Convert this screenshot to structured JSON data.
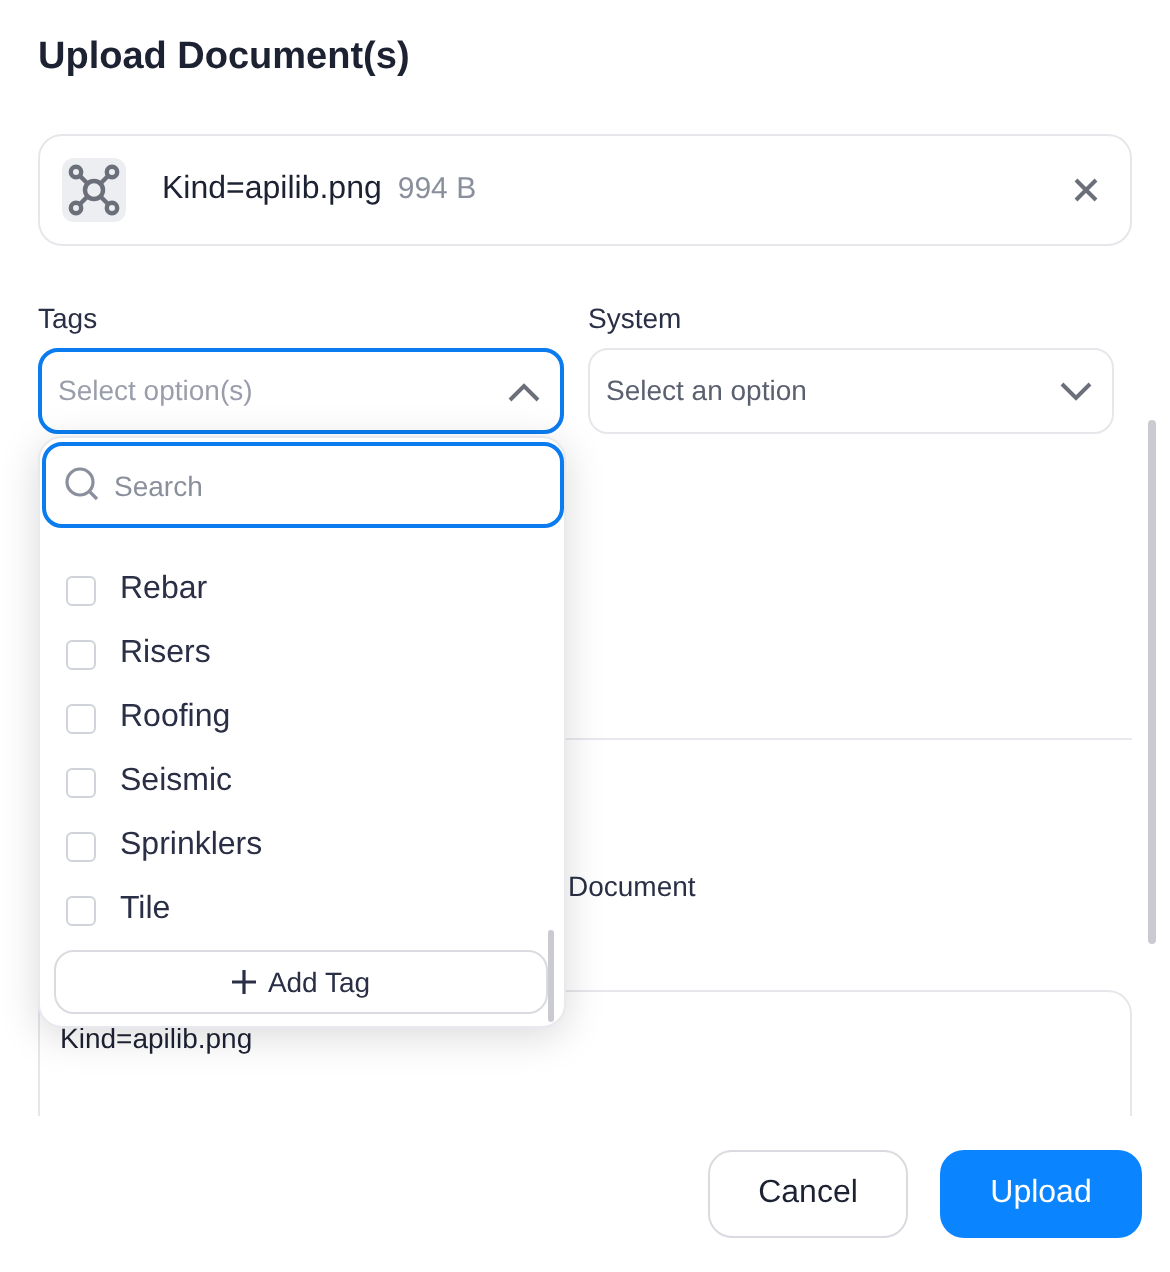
{
  "dialog": {
    "title": "Upload Document(s)"
  },
  "file": {
    "name": "Kind=apilib.png",
    "size": "994 B"
  },
  "tags": {
    "label": "Tags",
    "placeholder": "Select option(s)",
    "expanded": true,
    "search": {
      "placeholder": "Search"
    },
    "options": [
      {
        "label": "Rebar",
        "checked": false
      },
      {
        "label": "Risers",
        "checked": false
      },
      {
        "label": "Roofing",
        "checked": false
      },
      {
        "label": "Seismic",
        "checked": false
      },
      {
        "label": "Sprinklers",
        "checked": false
      },
      {
        "label": "Tile",
        "checked": false
      }
    ],
    "add_button": "Add Tag"
  },
  "system": {
    "label": "System",
    "placeholder": "Select an option",
    "expanded": false
  },
  "document_label": "Document",
  "description": {
    "value": "Kind=apilib.png"
  },
  "buttons": {
    "cancel": "Cancel",
    "upload": "Upload"
  }
}
